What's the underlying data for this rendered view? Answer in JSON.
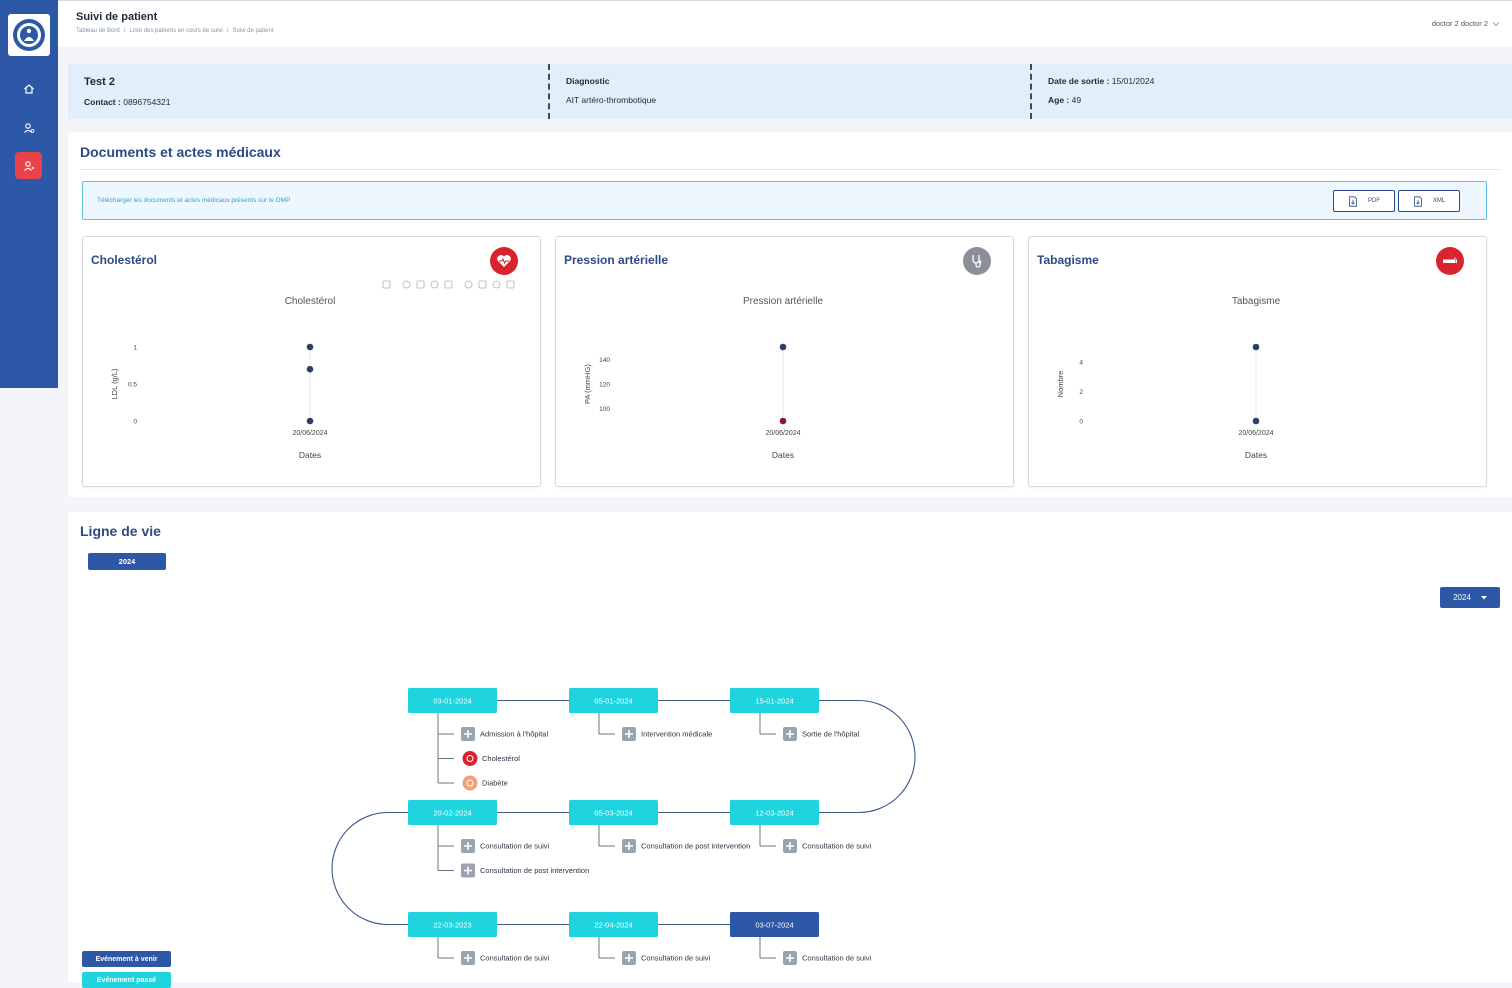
{
  "header": {
    "title": "Suivi de patient",
    "breadcrumbs": [
      "Tableau de Bord",
      "Liste des patients en cours de suivi",
      "Suivi de patient"
    ],
    "breadcrumb_sep": "/",
    "user": "doctor 2 doctor 2"
  },
  "patient": {
    "name": "Test 2",
    "contact_label": "Contact :",
    "contact": "0896754321",
    "diagnostic_label": "Diagnostic",
    "diagnostic": "AIT artéro-thrombotique",
    "discharge_label": "Date de sortie :",
    "discharge_date": "15/01/2024",
    "age_label": "Age :",
    "age": "49"
  },
  "documents": {
    "title": "Documents et actes médicaux",
    "dmp_text": "Télécharger les documents et actes médicaux présents sur le DMP",
    "pdf_label": "PDF",
    "xml_label": "XML"
  },
  "charts": [
    {
      "card_title": "Cholestérol",
      "badge_color": "#d9232d",
      "badge_icon": "heart-pulse-icon",
      "chart_data": {
        "type": "scatter",
        "title": "Cholestérol",
        "xlabel": "Dates",
        "ylabel": "LDL (g/L)",
        "x": [
          "20/06/2024",
          "20/06/2024",
          "20/06/2024"
        ],
        "y": [
          1,
          0.7,
          0
        ],
        "yticks": [
          0,
          0.5,
          1
        ],
        "ylim": [
          0,
          1
        ],
        "point_colors": [
          "#2c3e6b",
          "#2c3e6b",
          "#2c3e6b"
        ]
      }
    },
    {
      "card_title": "Pression artérielle",
      "badge_color": "#8a8f98",
      "badge_icon": "stethoscope-icon",
      "chart_data": {
        "type": "scatter",
        "title": "Pression artérielle",
        "xlabel": "Dates",
        "ylabel": "PA (mmHG)",
        "x": [
          "20/06/2024",
          "20/06/2024"
        ],
        "y": [
          150,
          90
        ],
        "yticks": [
          100,
          120,
          140
        ],
        "ylim": [
          90,
          150
        ],
        "point_colors": [
          "#2c3e6b",
          "#8b1a2b"
        ]
      }
    },
    {
      "card_title": "Tabagisme",
      "badge_color": "#d9232d",
      "badge_icon": "cigarette-icon",
      "chart_data": {
        "type": "scatter",
        "title": "Tabagisme",
        "xlabel": "Dates",
        "ylabel": "Nombre",
        "x": [
          "20/06/2024",
          "20/06/2024"
        ],
        "y": [
          5,
          0
        ],
        "yticks": [
          0,
          2,
          4
        ],
        "ylim": [
          0,
          5
        ],
        "point_colors": [
          "#2c3e6b",
          "#2c3e6b"
        ]
      }
    }
  ],
  "lifeline": {
    "title": "Ligne de vie",
    "year_chip": "2024",
    "year_select": "2024",
    "legend_upcoming": "Evénement à venir",
    "legend_past": "Evénement passé",
    "colors": {
      "past": "#1fd3df",
      "upcoming": "#2c58a7",
      "line": "#3a5a8a"
    },
    "events": [
      {
        "date": "03-01-2024",
        "state": "past",
        "items": [
          {
            "label": "Admission à l'hôpital",
            "icon": "plus-icon"
          },
          {
            "label": "Cholestérol",
            "icon": "cholesterol-icon"
          },
          {
            "label": "Diabète",
            "icon": "diabetes-icon"
          }
        ]
      },
      {
        "date": "05-01-2024",
        "state": "past",
        "items": [
          {
            "label": "Intervention médicale",
            "icon": "plus-icon"
          }
        ]
      },
      {
        "date": "15-01-2024",
        "state": "past",
        "items": [
          {
            "label": "Sortie de l'hôpital",
            "icon": "plus-icon"
          }
        ]
      },
      {
        "date": "20-02-2024",
        "state": "past",
        "items": [
          {
            "label": "Consultation de suivi",
            "icon": "plus-icon"
          },
          {
            "label": "Consultation de post intervention",
            "icon": "plus-icon"
          }
        ]
      },
      {
        "date": "05-03-2024",
        "state": "past",
        "items": [
          {
            "label": "Consultation de post intervention",
            "icon": "plus-icon"
          }
        ]
      },
      {
        "date": "12-03-2024",
        "state": "past",
        "items": [
          {
            "label": "Consultation de suivi",
            "icon": "plus-icon"
          }
        ]
      },
      {
        "date": "22-03-2023",
        "state": "past",
        "items": [
          {
            "label": "Consultation de suivi",
            "icon": "plus-icon"
          }
        ]
      },
      {
        "date": "22-04-2024",
        "state": "past",
        "items": [
          {
            "label": "Consultation de suivi",
            "icon": "plus-icon"
          }
        ]
      },
      {
        "date": "03-07-2024",
        "state": "upcoming",
        "items": [
          {
            "label": "Consultation de suivi",
            "icon": "plus-icon"
          }
        ]
      }
    ]
  }
}
